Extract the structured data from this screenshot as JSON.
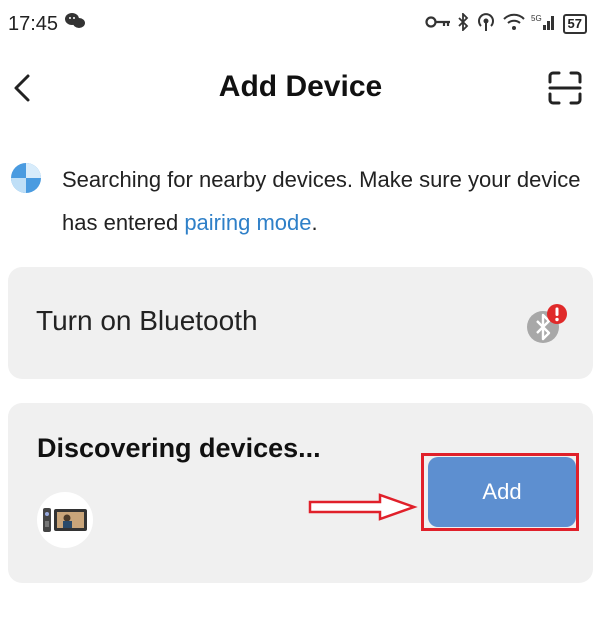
{
  "status_bar": {
    "time": "17:45",
    "left_icon": "wechat-icon",
    "battery": "57",
    "signal_label": "5G"
  },
  "header": {
    "title": "Add Device",
    "back_icon": "chevron-left-icon",
    "scan_icon": "scan-icon"
  },
  "search_info": {
    "text_before": "Searching for nearby devices. Make sure your device has entered ",
    "link": "pairing mode",
    "text_after": "."
  },
  "bluetooth_card": {
    "label": "Turn on Bluetooth",
    "icon": "bluetooth-warning-icon"
  },
  "discover_card": {
    "title": "Discovering devices...",
    "device_icon": "video-doorbell-icon",
    "add_label": "Add"
  },
  "colors": {
    "accent": "#5d8fd0",
    "link": "#2f80c8",
    "card_bg": "#f0f0f0",
    "annotation_red": "#e0202a"
  }
}
